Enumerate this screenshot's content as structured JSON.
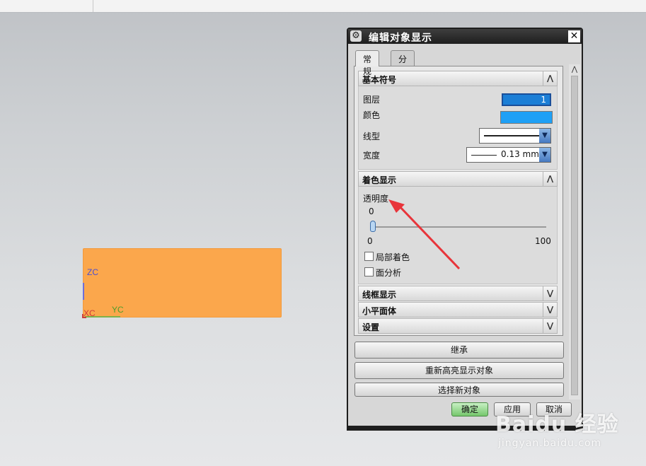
{
  "viewport": {
    "axes": {
      "z": "ZC",
      "y": "YC",
      "x": "XC"
    }
  },
  "dialog": {
    "title": "编辑对象显示",
    "tabs": [
      {
        "label": "常规",
        "active": true
      },
      {
        "label": "分析",
        "active": false
      }
    ],
    "basic": {
      "header": "基本符号",
      "layer_label": "图层",
      "layer_value": "1",
      "color_label": "颜色",
      "color_value": "#1ea0f6",
      "linetype_label": "线型",
      "width_label": "宽度",
      "width_value": "0.13 mm"
    },
    "shading": {
      "header": "着色显示",
      "transparency_label": "透明度",
      "current_value": "0",
      "min": "0",
      "max": "100",
      "partial_shading_label": "局部着色",
      "face_analysis_label": "面分析"
    },
    "collapsed_sections": [
      "线框显示",
      "小平面体",
      "设置"
    ],
    "actions": {
      "inherit": "继承",
      "rehighlight": "重新高亮显示对象",
      "select_new": "选择新对象"
    },
    "footer": {
      "ok": "确定",
      "apply": "应用",
      "cancel": "取消"
    }
  },
  "colors": {
    "object": "#fba74c",
    "annotation_arrow": "#e8343a"
  },
  "watermark": {
    "logo": "Baidu 经验",
    "url": "jingyan.baidu.com"
  }
}
